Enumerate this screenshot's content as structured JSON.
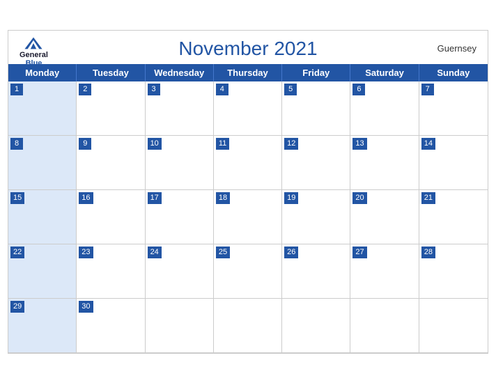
{
  "header": {
    "title": "November 2021",
    "country": "Guernsey",
    "logo": {
      "general": "General",
      "blue": "Blue"
    }
  },
  "days": [
    "Monday",
    "Tuesday",
    "Wednesday",
    "Thursday",
    "Friday",
    "Saturday",
    "Sunday"
  ],
  "weeks": [
    [
      1,
      2,
      3,
      4,
      5,
      6,
      7
    ],
    [
      8,
      9,
      10,
      11,
      12,
      13,
      14
    ],
    [
      15,
      16,
      17,
      18,
      19,
      20,
      21
    ],
    [
      22,
      23,
      24,
      25,
      26,
      27,
      28
    ],
    [
      29,
      30,
      null,
      null,
      null,
      null,
      null
    ]
  ],
  "accent_color": "#2255a4",
  "header_bg": "#dce8f8"
}
